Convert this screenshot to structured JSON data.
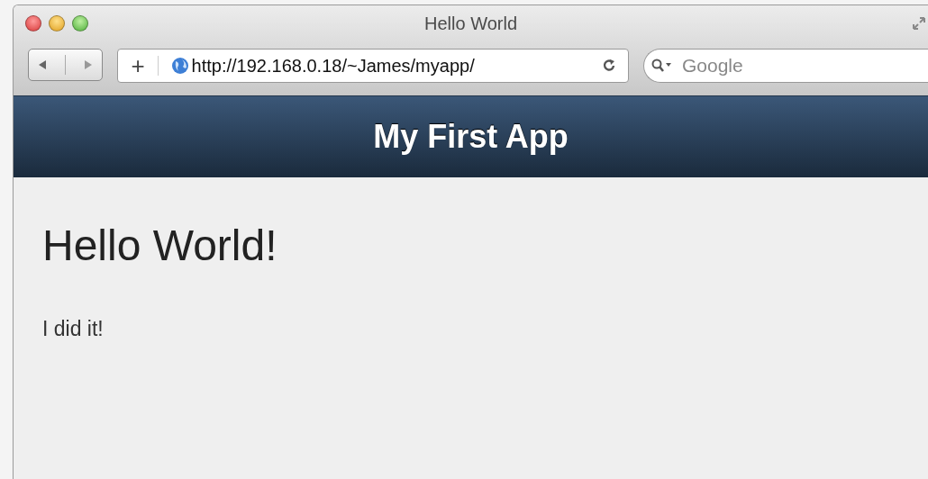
{
  "window": {
    "title": "Hello World"
  },
  "toolbar": {
    "new_tab": "+",
    "url": "http://192.168.0.18/~James/myapp/",
    "search": {
      "placeholder": "Google"
    }
  },
  "header": {
    "title": "My First App"
  },
  "content": {
    "heading": "Hello World!",
    "paragraph": "I did it!"
  }
}
